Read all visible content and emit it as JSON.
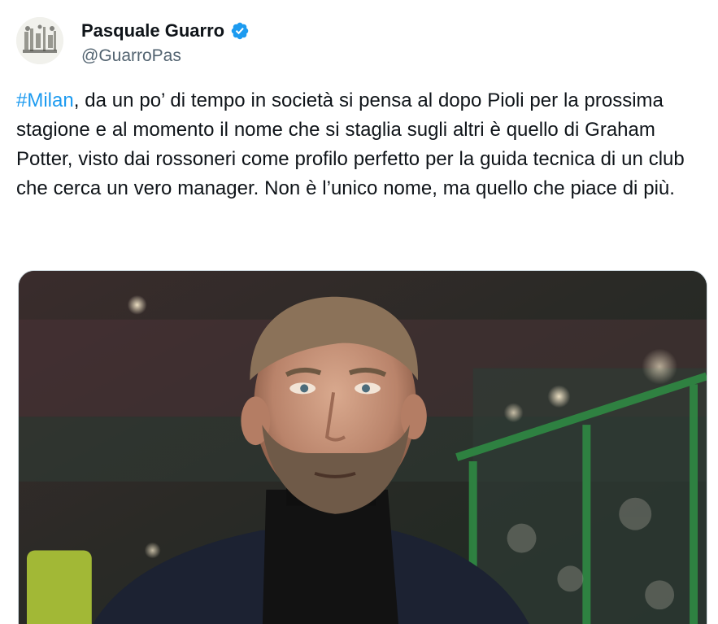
{
  "author": {
    "name": "Pasquale Guarro",
    "handle": "@GuarroPas",
    "verified_icon": "verified-badge-icon",
    "verified_color": "#1d9bf0"
  },
  "tweet": {
    "hashtag": "#Milan",
    "text_after_hashtag": ", da un po’ di tempo in società si pensa al dopo Pioli per la prossima stagione e al momento il nome che si staglia sugli altri è quello di Graham Potter, visto dai rossoneri come profilo perfetto per la guida tecnica di un club che cerca un vero manager. Non è l’unico nome, ma quello che piace di più."
  },
  "colors": {
    "text": "#0f1419",
    "secondary": "#536471",
    "link": "#1d9bf0"
  }
}
